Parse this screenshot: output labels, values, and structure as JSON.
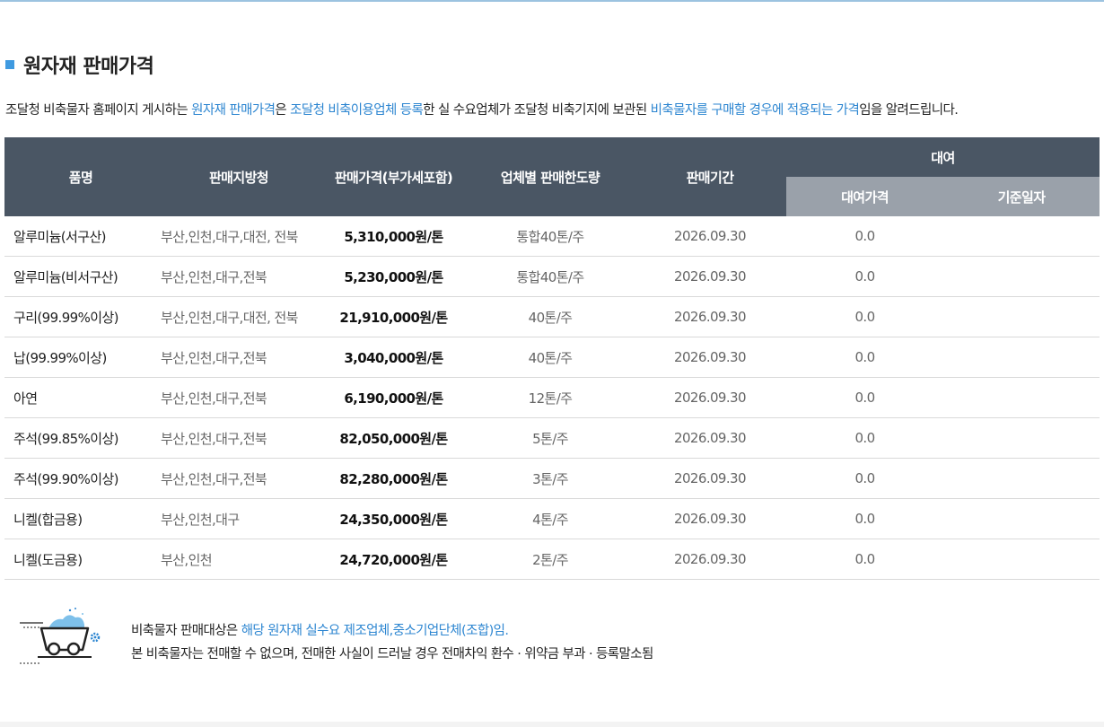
{
  "header": {
    "title": "원자재 판매가격"
  },
  "description": {
    "p1": "조달청 비축물자 홈페이지 게시하는 ",
    "h1": "원자재 판매가격",
    "p2": "은 ",
    "h2": "조달청 비축이용업체 등록",
    "p3": "한 실 수요업체가 조달청 비축기지에 보관된 ",
    "h3": "비축물자를 구매할 경우에 적용되는 가격",
    "p4": "임을 알려드립니다."
  },
  "table": {
    "headers": {
      "item": "품명",
      "region": "판매지방청",
      "price": "판매가격(부가세포함)",
      "limit": "업체별 판매한도량",
      "period": "판매기간",
      "rental": "대여",
      "rental_price": "대여가격",
      "base_date": "기준일자"
    },
    "rows": [
      {
        "item": "알루미늄(서구산)",
        "region": "부산,인천,대구,대전, 전북",
        "price": "5,310,000원/톤",
        "limit": "통합40톤/주",
        "period": "2026.09.30",
        "rental_price": "0.0",
        "base_date": ""
      },
      {
        "item": "알루미늄(비서구산)",
        "region": "부산,인천,대구,전북",
        "price": "5,230,000원/톤",
        "limit": "통합40톤/주",
        "period": "2026.09.30",
        "rental_price": "0.0",
        "base_date": ""
      },
      {
        "item": "구리(99.99%이상)",
        "region": "부산,인천,대구,대전, 전북",
        "price": "21,910,000원/톤",
        "limit": "40톤/주",
        "period": "2026.09.30",
        "rental_price": "0.0",
        "base_date": ""
      },
      {
        "item": "납(99.99%이상)",
        "region": "부산,인천,대구,전북",
        "price": "3,040,000원/톤",
        "limit": "40톤/주",
        "period": "2026.09.30",
        "rental_price": "0.0",
        "base_date": ""
      },
      {
        "item": "아연",
        "region": "부산,인천,대구,전북",
        "price": "6,190,000원/톤",
        "limit": "12톤/주",
        "period": "2026.09.30",
        "rental_price": "0.0",
        "base_date": ""
      },
      {
        "item": "주석(99.85%이상)",
        "region": "부산,인천,대구,전북",
        "price": "82,050,000원/톤",
        "limit": "5톤/주",
        "period": "2026.09.30",
        "rental_price": "0.0",
        "base_date": ""
      },
      {
        "item": "주석(99.90%이상)",
        "region": "부산,인천,대구,전북",
        "price": "82,280,000원/톤",
        "limit": "3톤/주",
        "period": "2026.09.30",
        "rental_price": "0.0",
        "base_date": ""
      },
      {
        "item": "니켈(합금용)",
        "region": "부산,인천,대구",
        "price": "24,350,000원/톤",
        "limit": "4톤/주",
        "period": "2026.09.30",
        "rental_price": "0.0",
        "base_date": ""
      },
      {
        "item": "니켈(도금용)",
        "region": "부산,인천",
        "price": "24,720,000원/톤",
        "limit": "2톤/주",
        "period": "2026.09.30",
        "rental_price": "0.0",
        "base_date": ""
      }
    ]
  },
  "notice": {
    "icon": "mining-cart-icon",
    "line1_prefix": "비축물자 판매대상은 ",
    "line1_highlight": "해당 원자재 실수요 제조업체,중소기업단체(조합)임.",
    "line2": "본 비축물자는 전매할 수 없으며, 전매한 사실이 드러날 경우 전매차익 환수 · 위약금 부과 · 등록말소됨"
  },
  "colors": {
    "accent": "#2d86d1",
    "header_bg": "#4a5664",
    "subheader_bg": "#9aa1aa",
    "bullet": "#3f9ae0"
  }
}
